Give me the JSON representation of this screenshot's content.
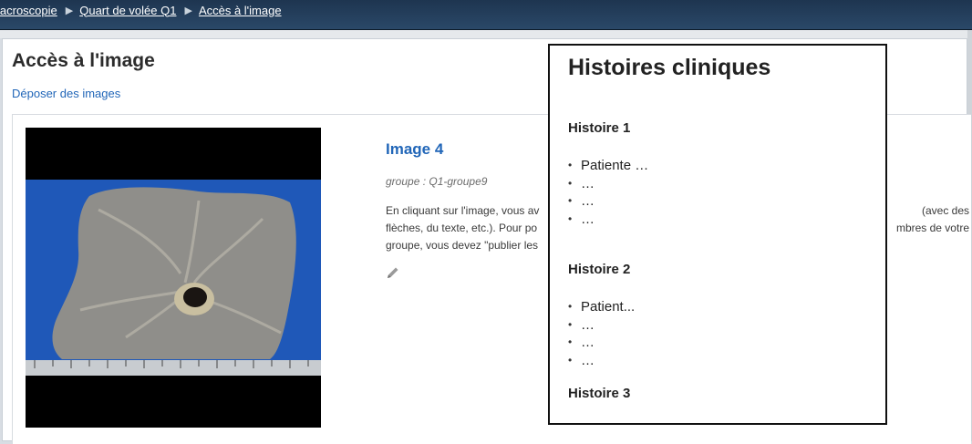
{
  "breadcrumb": [
    {
      "label": "lacroscopie"
    },
    {
      "label": "Quart de volée Q1"
    },
    {
      "label": "Accès à l'image"
    }
  ],
  "page": {
    "title": "Accès à l'image",
    "upload_link": "Déposer des images"
  },
  "image_card": {
    "title": "Image 4",
    "group": "groupe : Q1-groupe9",
    "description_line1": "En cliquant sur l'image, vous av",
    "description_line1_end": "(avec des",
    "description_line2": "flèches, du texte, etc.). Pour po",
    "description_line2_end": "mbres de votre",
    "description_line3": "groupe, vous devez \"publier les",
    "edit_icon": "pencil-icon"
  },
  "popup": {
    "title": "Histoires cliniques",
    "stories": [
      {
        "heading": "Histoire 1",
        "items": [
          "Patiente …",
          "…",
          "…",
          "…"
        ]
      },
      {
        "heading": "Histoire 2",
        "items": [
          "Patient...",
          "…",
          "…",
          "…"
        ]
      },
      {
        "heading": "Histoire 3",
        "items": []
      }
    ]
  },
  "colors": {
    "topbar": "#1e3550",
    "link": "#2166b8",
    "specimen_background": "#1f58b8"
  }
}
